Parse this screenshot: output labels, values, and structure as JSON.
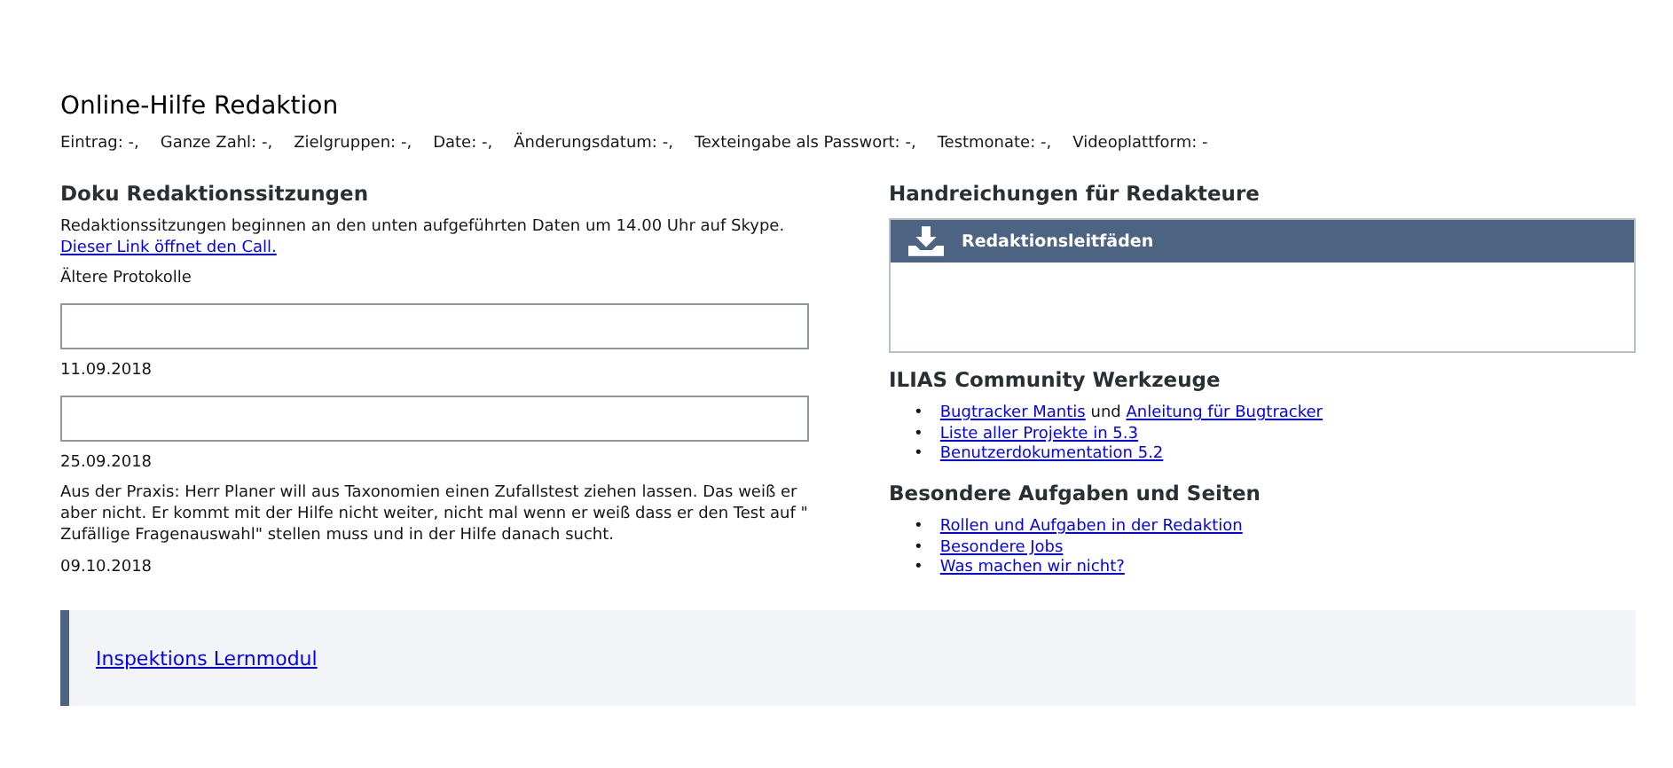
{
  "page_title": "Online-Hilfe Redaktion",
  "metadata": [
    {
      "label": "Eintrag:",
      "value": "-,"
    },
    {
      "label": "Ganze Zahl:",
      "value": "-,"
    },
    {
      "label": "Zielgruppen:",
      "value": "-,"
    },
    {
      "label": "Date:",
      "value": "-,"
    },
    {
      "label": "Änderungsdatum:",
      "value": "-,"
    },
    {
      "label": "Texteingabe als Passwort:",
      "value": "-,"
    },
    {
      "label": "Testmonate:",
      "value": "-,"
    },
    {
      "label": "Videoplattform:",
      "value": "-"
    }
  ],
  "left": {
    "heading": "Doku Redaktionssitzungen",
    "blocks": [
      {
        "kind": "paragraph",
        "text": "Redaktionssitzungen beginnen an den unten aufgeführten Daten um 14.00 Uhr auf Skype."
      },
      {
        "kind": "link",
        "text": "Dieser Link öffnet den Call."
      },
      {
        "kind": "paragraph",
        "text": "Ältere Protokolle"
      },
      {
        "kind": "frame"
      },
      {
        "kind": "paragraph",
        "text": "11.09.2018"
      },
      {
        "kind": "frame"
      },
      {
        "kind": "paragraph",
        "text": "25.09.2018"
      },
      {
        "kind": "paragraph",
        "text": "Aus der Praxis: Herr Planer will aus Taxonomien einen Zufallstest ziehen lassen. Das weiß er aber nicht. Er kommt mit der Hilfe nicht weiter, nicht mal wenn er weiß dass er den Test auf \" Zufällige Fragenauswahl\" stellen muss und in der Hilfe danach sucht."
      },
      {
        "kind": "paragraph",
        "text": "09.10.2018"
      }
    ]
  },
  "right": {
    "heading": "Handreichungen für Redakteure",
    "panel": {
      "title": "Redaktionsleitfäden"
    },
    "sections": [
      {
        "heading": "ILIAS Community Werkzeuge",
        "items": [
          {
            "bullet": "•",
            "parts": [
              {
                "kind": "link",
                "text": "Bugtracker Mantis"
              },
              {
                "kind": "text",
                "text": "und"
              },
              {
                "kind": "link",
                "text": "Anleitung für Bugtracker"
              }
            ]
          },
          {
            "bullet": "•",
            "parts": [
              {
                "kind": "link",
                "text": "Liste aller Projekte in 5.3"
              }
            ]
          },
          {
            "bullet": "•",
            "parts": [
              {
                "kind": "link",
                "text": "Benutzerdokumentation 5.2"
              }
            ]
          }
        ]
      },
      {
        "heading": "Besondere Aufgaben und Seiten",
        "items": [
          {
            "bullet": "•",
            "parts": [
              {
                "kind": "link",
                "text": "Rollen und Aufgaben in der Redaktion"
              }
            ]
          },
          {
            "bullet": "•",
            "parts": [
              {
                "kind": "link",
                "text": "Besondere Jobs"
              }
            ]
          },
          {
            "bullet": "•",
            "parts": [
              {
                "kind": "link",
                "text": "Was machen wir nicht?"
              }
            ]
          }
        ]
      }
    ]
  },
  "callout": {
    "link": "Inspektions Lernmodul"
  }
}
